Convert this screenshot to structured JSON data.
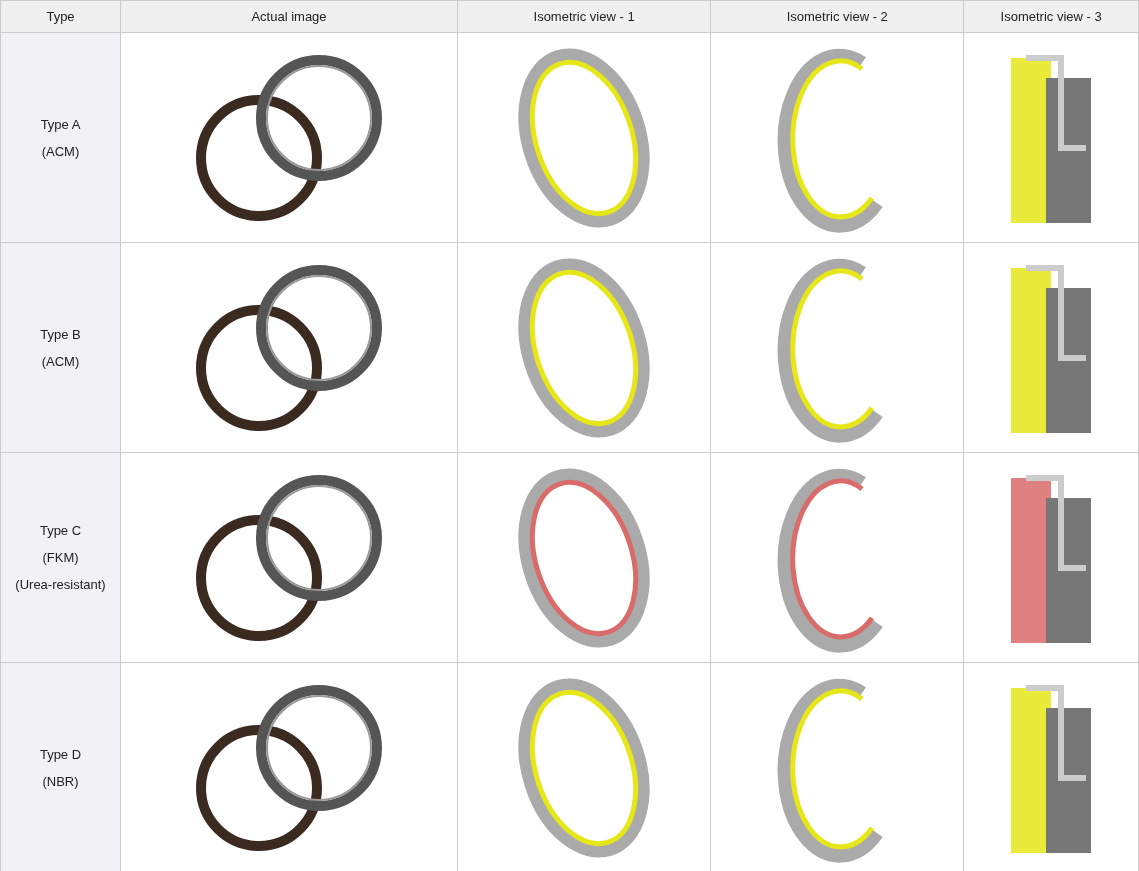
{
  "table": {
    "columns": [
      "Type",
      "Actual image",
      "Isometric view - 1",
      "Isometric view - 2",
      "Isometric view - 3"
    ],
    "rows": [
      {
        "type_lines": [
          "Type A",
          "(ACM)"
        ],
        "color": "#e6e619"
      },
      {
        "type_lines": [
          "Type B",
          "(ACM)"
        ],
        "color": "#e6e619"
      },
      {
        "type_lines": [
          "Type C",
          "(FKM)",
          "(Urea-resistant)"
        ],
        "color": "#d96b6b"
      },
      {
        "type_lines": [
          "Type D",
          "(NBR)"
        ],
        "color": "#e6e619"
      }
    ]
  }
}
